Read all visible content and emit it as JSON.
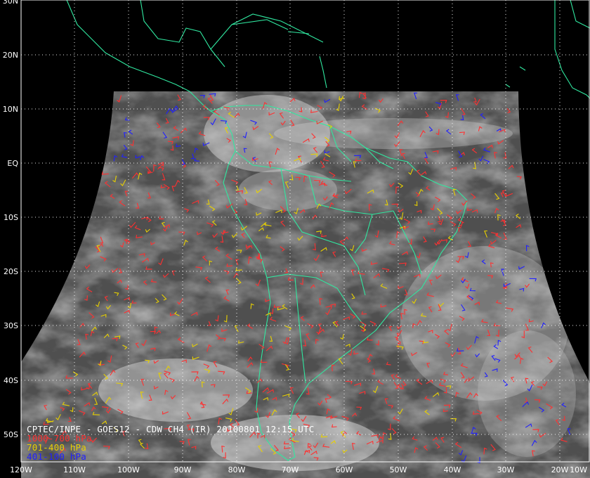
{
  "title": "CPTEC/INPE - GOES12 - CDW CH4 (IR) 20100801 12:15 UTC",
  "legend": [
    {
      "label": "1000-700 hPa",
      "color": "#ff3030"
    },
    {
      "label": "701-400 hPa",
      "color": "#e8d000"
    },
    {
      "label": "401-100 hPa",
      "color": "#2020ff"
    }
  ],
  "lat_labels": [
    "30N",
    "20N",
    "10N",
    "EQ",
    "10S",
    "20S",
    "30S",
    "40S",
    "50S"
  ],
  "lon_labels": [
    "120W",
    "110W",
    "100W",
    "90W",
    "80W",
    "70W",
    "60W",
    "50W",
    "40W",
    "30W",
    "20W",
    "10W"
  ],
  "colors": {
    "background": "#000000",
    "coastline": "#30e8a0",
    "grid": "#ffffff",
    "imagery": "#5a5a5a"
  }
}
